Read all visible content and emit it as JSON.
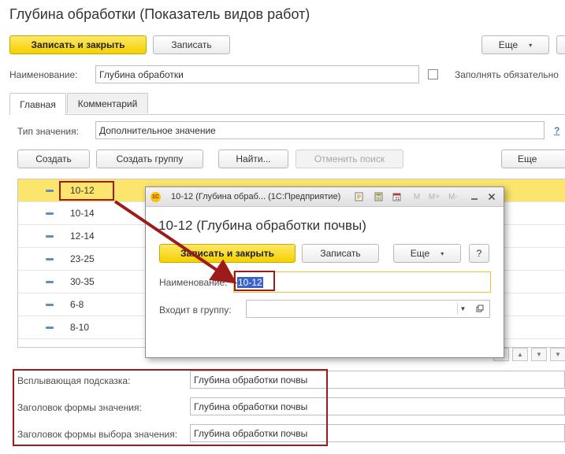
{
  "window": {
    "title": "Глубина обработки (Показатель видов работ)"
  },
  "toolbar": {
    "save_close": "Записать и закрыть",
    "save": "Записать",
    "more": "Еще",
    "more_caret": "▾"
  },
  "name_field": {
    "label": "Наименование:",
    "value": "Глубина обработки"
  },
  "fill_required": {
    "label": "Заполнять обязательно",
    "checked": false
  },
  "tabs": [
    {
      "label": "Главная"
    },
    {
      "label": "Комментарий"
    }
  ],
  "value_type": {
    "label": "Тип значения:",
    "value": "Дополнительное значение",
    "help": "?"
  },
  "list_toolbar": {
    "create": "Создать",
    "create_group": "Создать группу",
    "find": "Найти...",
    "cancel_search": "Отменить поиск",
    "more": "Еще"
  },
  "values_list": {
    "rows": [
      {
        "label": "10-12"
      },
      {
        "label": "10-14"
      },
      {
        "label": "12-14"
      },
      {
        "label": "23-25"
      },
      {
        "label": "30-35"
      },
      {
        "label": "6-8"
      },
      {
        "label": "8-10"
      }
    ],
    "selected_index": 0
  },
  "bottom_fields": [
    {
      "label": "Всплывающая подсказка:",
      "value": "Глубина обработки почвы"
    },
    {
      "label": "Заголовок формы значения:",
      "value": "Глубина обработки почвы"
    },
    {
      "label": "Заголовок формы выбора значения:",
      "value": "Глубина обработки почвы"
    }
  ],
  "dialog": {
    "title": "10-12 (Глубина обраб... (1С:Предприятие)",
    "logo": "1С",
    "toolbar_icons": [
      "bookmark-icon",
      "calculator-icon",
      "calendar-icon",
      "M",
      "M+",
      "M-"
    ],
    "heading": "10-12 (Глубина обработки почвы)",
    "save_close": "Записать и закрыть",
    "save": "Записать",
    "more": "Еще",
    "help": "?",
    "name_label": "Наименование:",
    "name_value": "10-12",
    "group_label": "Входит в группу:",
    "group_value": ""
  },
  "colors": {
    "accent_yellow": "#f5d000",
    "highlight_red": "#9e1b1b",
    "selection_blue": "#3a63c9",
    "row_selected": "#fbe56d"
  }
}
